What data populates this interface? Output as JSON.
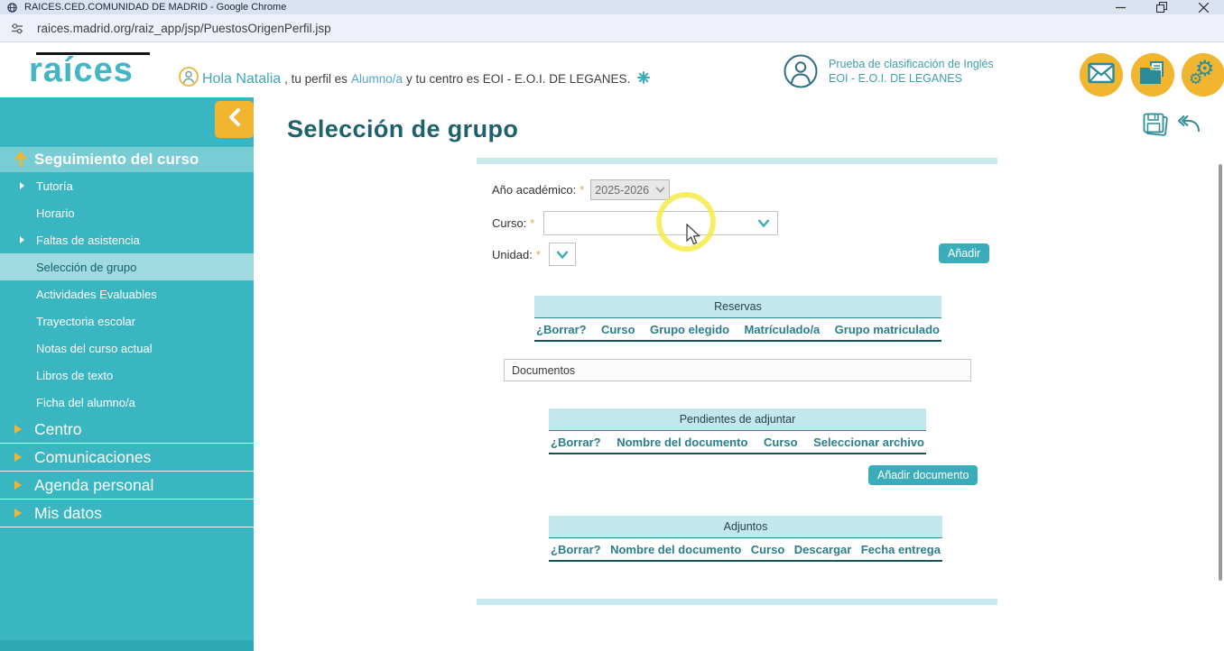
{
  "browser": {
    "title": "RAICES.CED.COMUNIDAD DE MADRID - Google Chrome",
    "url": "raices.madrid.org/raiz_app/jsp/PuestosOrigenPerfil.jsp"
  },
  "header": {
    "logo_text": "raíces",
    "greeting_name": "Hola Natalia",
    "greeting_mid": ", tu perfil es",
    "greeting_profile": "Alumno/a",
    "greeting_end": "y tu centro es EOI - E.O.I. DE LEGANES.",
    "context_line1": "Prueba de clasificación de Inglés",
    "context_line2": "EOI - E.O.I. DE LEGANES"
  },
  "sidebar": {
    "section_header": "Seguimiento del curso",
    "items": [
      "Tutoría",
      "Horario",
      "Faltas de asistencia",
      "Selección de grupo",
      "Actividades Evaluables",
      "Trayectoria escolar",
      "Notas del curso actual",
      "Libros de texto",
      "Ficha del alumno/a"
    ],
    "majors": [
      "Centro",
      "Comunicaciones",
      "Agenda personal",
      "Mis datos"
    ]
  },
  "main": {
    "title": "Selección de grupo",
    "required_marker": "*",
    "form": {
      "year_label": "Año académico:",
      "year_value": "2025-2026",
      "curso_label": "Curso:",
      "unidad_label": "Unidad:",
      "add_button": "Añadir"
    },
    "reservas": {
      "title": "Reservas",
      "columns": [
        "¿Borrar?",
        "Curso",
        "Grupo elegido",
        "Matrículado/a",
        "Grupo matriculado"
      ]
    },
    "documentos_label": "Documentos",
    "pendientes": {
      "title": "Pendientes de adjuntar",
      "columns": [
        "¿Borrar?",
        "Nombre del documento",
        "Curso",
        "Seleccionar archivo"
      ],
      "add_button": "Añadir documento"
    },
    "adjuntos": {
      "title": "Adjuntos",
      "columns": [
        "¿Borrar?",
        "Nombre del documento",
        "Curso",
        "Descargar",
        "Fecha entrega"
      ]
    }
  },
  "colors": {
    "teal": "#39b6c1",
    "teal_dark": "#1e616d",
    "yellow": "#f2b530",
    "band_teal": "#c3e7ec",
    "button_teal": "#3badba"
  }
}
